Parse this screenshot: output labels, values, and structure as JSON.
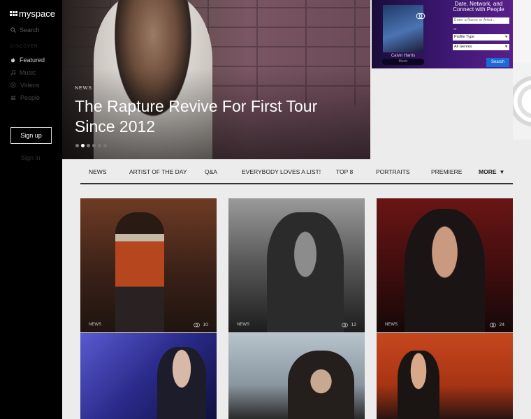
{
  "brand": {
    "name": "myspace"
  },
  "sidebar": {
    "search_label": "Search",
    "discover_label": "DISCOVER",
    "items": [
      {
        "label": "Featured",
        "icon": "flame-icon"
      },
      {
        "label": "Music",
        "icon": "music-note-icon"
      },
      {
        "label": "Videos",
        "icon": "play-icon"
      },
      {
        "label": "People",
        "icon": "people-icon"
      }
    ],
    "signup_label": "Sign up",
    "signin_label": "Sign in"
  },
  "hero": {
    "tag": "NEWS",
    "headline": "The Rapture Revive For First Tour Since 2012",
    "slides": 6,
    "active_slide": 2
  },
  "ad": {
    "title": "Date, Network, and Connect with People",
    "name_placeholder": "Enter a Name or Artist...",
    "or_label": "or",
    "profile_type": "Profile Type",
    "genres": "All Genres",
    "search_label": "Search",
    "artist_caption": "Calvin Harris",
    "artist_pill": "Music"
  },
  "tabs": [
    "NEWS",
    "ARTIST OF THE DAY",
    "Q&A",
    "EVERYBODY LOVES A LIST!",
    "TOP 8",
    "PORTRAITS",
    "PREMIERE",
    "MORE"
  ],
  "cards": [
    {
      "tag": "NEWS",
      "count": "10"
    },
    {
      "tag": "NEWS",
      "count": "12"
    },
    {
      "tag": "NEWS",
      "count": "24"
    },
    {
      "tag": "",
      "count": ""
    },
    {
      "tag": "",
      "count": ""
    },
    {
      "tag": "",
      "count": ""
    }
  ],
  "colors": {
    "sidebar": "#000000",
    "accent_button": "#1a6ad8",
    "page_bg": "#ececec"
  }
}
